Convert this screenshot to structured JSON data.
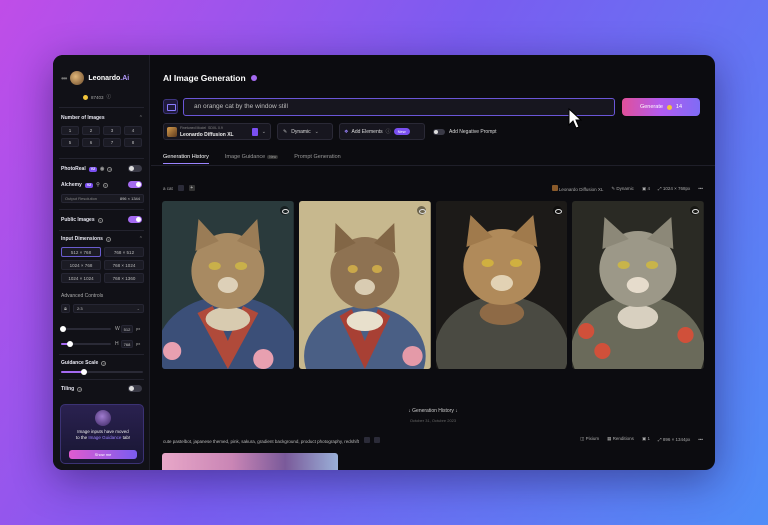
{
  "app": {
    "brand": "Leonardo",
    "brand_ai": ".Ai",
    "tokens": "87403",
    "page_title": "AI Image Generation"
  },
  "sidebar": {
    "number_of_images_label": "Number of Images",
    "counts": [
      "1",
      "2",
      "3",
      "4",
      "5",
      "6",
      "7",
      "8"
    ],
    "photoreal_label": "PhotoReal",
    "photoreal_badge": "V2",
    "alchemy_label": "Alchemy",
    "alchemy_badge": "V2",
    "output_resolution_label": "Output Resolution",
    "output_resolution_value": "896 × 1344",
    "public_images_label": "Public Images",
    "input_dimensions_label": "Input Dimensions",
    "dimensions": [
      "512 × 768",
      "768 × 512",
      "1024 × 768",
      "768 × 1024",
      "1024 × 1024",
      "768 × 1360"
    ],
    "advanced_controls_label": "Advanced Controls",
    "ratio_value": "2:3",
    "width_label": "W",
    "width_value": "512",
    "height_label": "H",
    "height_value": "768",
    "px_unit": "px",
    "guidance_scale_label": "Guidance Scale",
    "tiling_label": "Tiling",
    "promo_text_1": "Image inputs have moved",
    "promo_text_2": "to the",
    "promo_link": "Image Guidance",
    "promo_text_3": "tab!",
    "promo_button": "Show me",
    "photoreal_on": false,
    "alchemy_on": true,
    "public_images_on": true,
    "tiling_on": false
  },
  "prompt": {
    "value": "an orange cat by the window still",
    "generate_label": "Generate",
    "generate_cost": "14"
  },
  "toolbar": {
    "model_caption": "Finetuned Model",
    "model_version": "SDXL 0.9",
    "model_name": "Leonardo Diffusion XL",
    "style_label": "Dynamic",
    "elements_label": "Add Elements",
    "elements_badge": "New",
    "negative_prompt_label": "Add Negative Prompt"
  },
  "tabs": [
    {
      "label": "Generation History",
      "active": true
    },
    {
      "label": "Image Guidance",
      "badge": "New"
    },
    {
      "label": "Prompt Generation"
    }
  ],
  "generation": {
    "prompt": "a cat",
    "model": "Leonardo Diffusion XL",
    "style": "Dynamic",
    "count": "4",
    "size": "1024 × 768px"
  },
  "images": [
    {
      "alt": "cat portrait 1"
    },
    {
      "alt": "cat portrait 2"
    },
    {
      "alt": "cat portrait 3"
    },
    {
      "alt": "cat portrait 4"
    }
  ],
  "history": {
    "label": "Generation History",
    "date": "October 31, Octubre 2023"
  },
  "next_prompt": {
    "text": "cute pastelbot, japanese themed, pink, sakura, gradient background, product photography, redshift",
    "model": "Pixium",
    "style": "Renditions",
    "count": "1",
    "size": "896 × 1344px"
  },
  "colors": {
    "accent": "#a46af0",
    "background": "#0c0c10",
    "generate_gradient_start": "#e0509a",
    "generate_gradient_end": "#7f6cf5"
  }
}
